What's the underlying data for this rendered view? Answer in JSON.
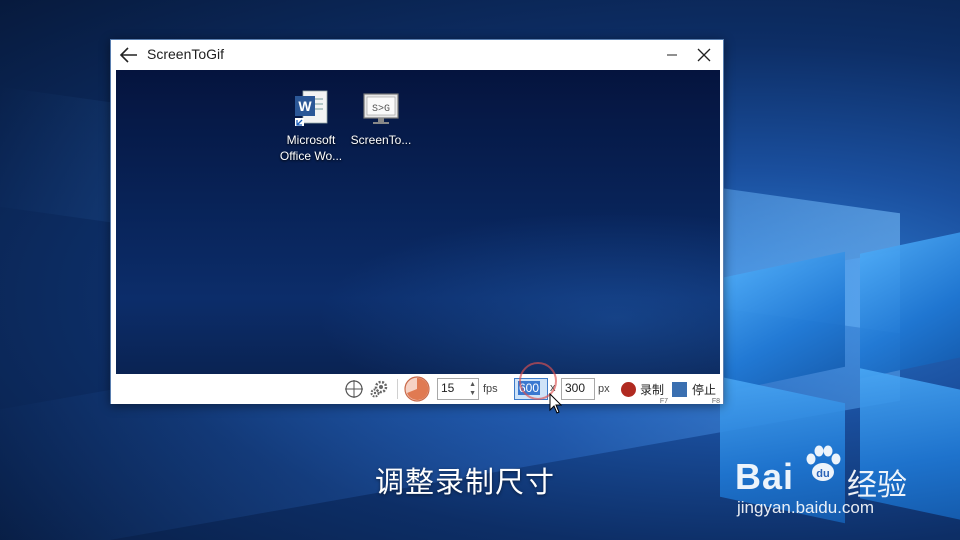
{
  "window": {
    "title": "ScreenToGif"
  },
  "desktop_icons": [
    {
      "label_line1": "Microsoft",
      "label_line2": "Office Wo...",
      "icon": "word-icon"
    },
    {
      "label_line1": "ScreenTo...",
      "label_line2": "",
      "icon": "screentogif-icon"
    }
  ],
  "toolbar": {
    "fps_value": "15",
    "fps_unit": "fps",
    "width_value": "600",
    "times_sign": "x",
    "height_value": "300",
    "px_unit": "px",
    "record_label": "录制",
    "record_hotkey": "F7",
    "stop_label": "停止",
    "stop_hotkey": "F8"
  },
  "subtitle": "调整录制尺寸",
  "watermark": {
    "brand_latin": "Bai",
    "brand_cn": "经验",
    "url": "jingyan.baidu.com"
  },
  "colors": {
    "record": "#b02a20",
    "stop": "#3a6fb0",
    "selection": "#3b78d0"
  }
}
